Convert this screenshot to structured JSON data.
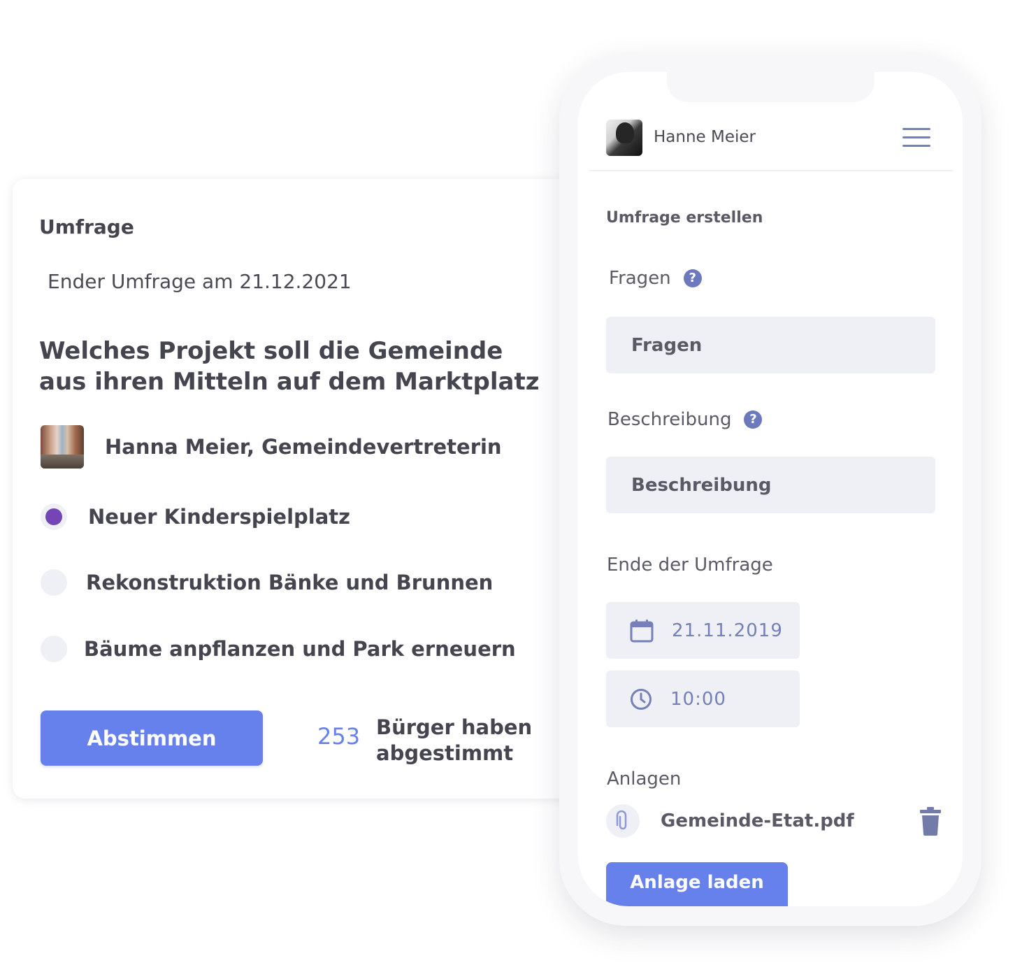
{
  "survey": {
    "heading": "Umfrage",
    "end_date_text": "Ender Umfrage am 21.12.2021",
    "question": "Welches Projekt soll die Gemeinde aus ihren Mitteln auf dem Marktplatz",
    "author": "Hanna Meier, Gemeindevertreterin",
    "options": [
      {
        "label": "Neuer Kinderspielplatz",
        "selected": true
      },
      {
        "label": "Rekonstruktion Bänke und Brunnen",
        "selected": false
      },
      {
        "label": "Bäume anpflanzen und Park erneuern",
        "selected": false
      }
    ],
    "vote_button": "Abstimmen",
    "vote_count": "253",
    "vote_count_text": "Bürger haben abgestimmt"
  },
  "phone": {
    "user_name": "Hanne Meier",
    "section_title": "Umfrage erstellen",
    "questions_label": "Fragen",
    "questions_placeholder": "Fragen",
    "description_label": "Beschreibung",
    "description_placeholder": "Beschreibung",
    "end_label": "Ende der Umfrage",
    "end_date": "21.11.2019",
    "end_time": "10:00",
    "attachments_label": "Anlagen",
    "attachment_name": "Gemeinde-Etat.pdf",
    "upload_button": "Anlage laden"
  },
  "colors": {
    "accent": "#6680ec",
    "radio_selected": "#7446b5",
    "field_background": "#eff0f6",
    "icon": "#7580b8"
  },
  "icons": {
    "menu": "hamburger-menu-icon",
    "help": "question-circle-icon",
    "calendar": "calendar-icon",
    "clock": "clock-icon",
    "attachment": "paperclip-icon",
    "delete": "trash-icon"
  }
}
